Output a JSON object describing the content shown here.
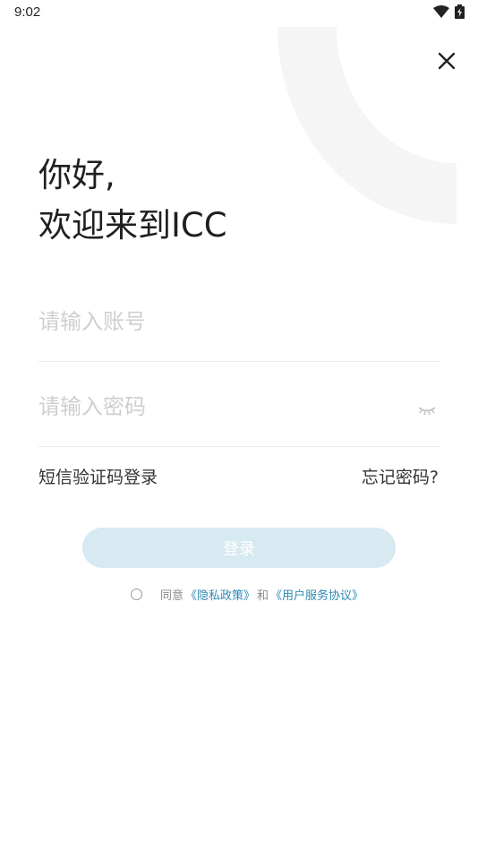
{
  "status_bar": {
    "time": "9:02"
  },
  "header": {
    "close_icon": "close-icon"
  },
  "greeting": {
    "line1": "你好,",
    "line2": "欢迎来到ICC"
  },
  "form": {
    "account_placeholder": "请输入账号",
    "account_value": "",
    "password_placeholder": "请输入密码",
    "password_value": "",
    "password_toggle_icon": "eye-closed-icon"
  },
  "links": {
    "sms_login": "短信验证码登录",
    "forgot_password": "忘记密码?"
  },
  "login_button": {
    "label": "登录"
  },
  "agreement": {
    "agree_text": "同意",
    "privacy_policy": "《隐私政策》",
    "and_text": "和",
    "user_agreement": "《用户服务协议》",
    "checked": false
  },
  "colors": {
    "accent_link": "#2f8ab5",
    "login_button_bg": "#d7e9f1",
    "placeholder": "#cfcfcf",
    "decoration": "#f5f5f5"
  }
}
